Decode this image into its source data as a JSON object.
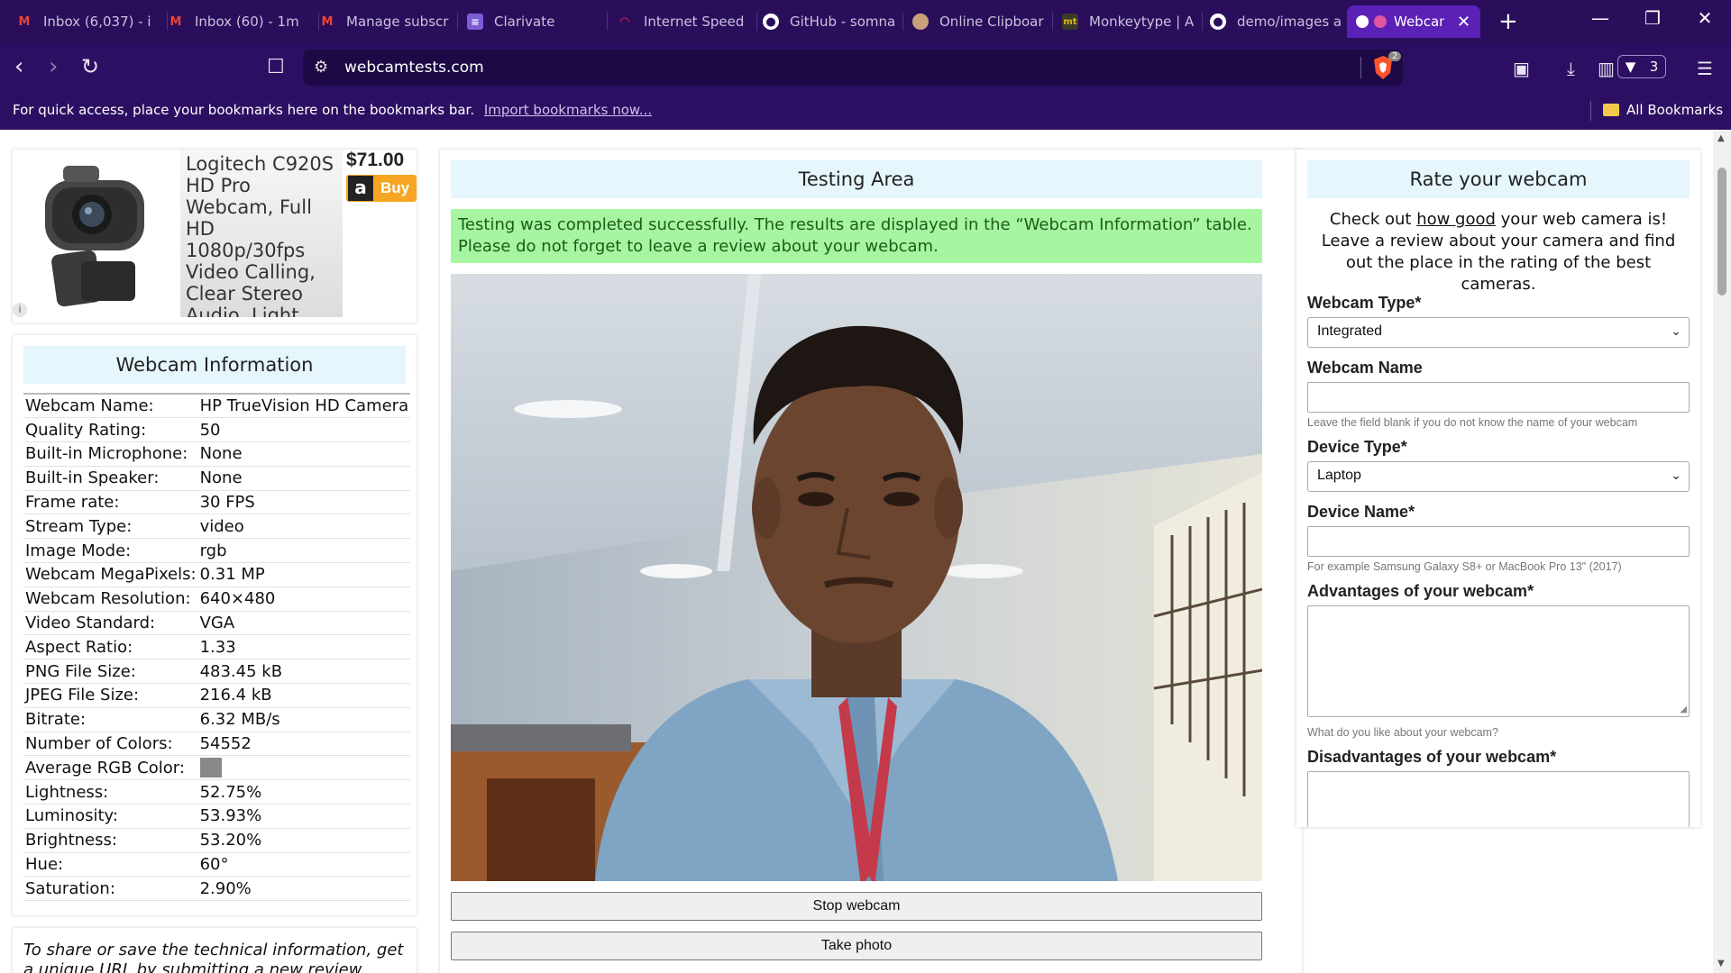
{
  "browser": {
    "tabs": [
      {
        "label": "Inbox (6,037) - i",
        "icon": "gmail-icon"
      },
      {
        "label": "Inbox (60) - 1m",
        "icon": "gmail-icon"
      },
      {
        "label": "Manage subscri",
        "icon": "gmail-icon"
      },
      {
        "label": "Clarivate",
        "icon": "clarivate-icon"
      },
      {
        "label": "Internet Speed",
        "icon": "speedtest-icon"
      },
      {
        "label": "GitHub - somna",
        "icon": "github-icon"
      },
      {
        "label": "Online Clipboar",
        "icon": "clipboard-icon"
      },
      {
        "label": "Monkeytype | A",
        "icon": "monkeytype-icon",
        "icon_text": "mt"
      },
      {
        "label": "demo/images a",
        "icon": "github-icon"
      },
      {
        "label": "Webcam",
        "icon": "webcam-icon",
        "active": true
      }
    ],
    "url": "webcamtests.com",
    "shield_count": "2",
    "rewards_count": "3",
    "bookmarks_bar": {
      "text": "For quick access, place your bookmarks here on the bookmarks bar.",
      "import_link": "Import bookmarks now...",
      "all_bookmarks": "All Bookmarks"
    }
  },
  "ad": {
    "description": "Logitech C920S HD Pro Webcam, Full HD 1080p/30fps Video Calling, Clear Stereo Audio, Light Correction",
    "price": "$71.00",
    "buy_label": "Buy",
    "amazon_logo": "a",
    "info_glyph": "i"
  },
  "webcam_info": {
    "heading": "Webcam Information",
    "rows": [
      {
        "key": "Webcam Name:",
        "value": "HP TrueVision HD Camera"
      },
      {
        "key": "Quality Rating:",
        "value": "50"
      },
      {
        "key": "Built-in Microphone:",
        "value": "None"
      },
      {
        "key": "Built-in Speaker:",
        "value": "None"
      },
      {
        "key": "Frame rate:",
        "value": "30 FPS"
      },
      {
        "key": "Stream Type:",
        "value": "video"
      },
      {
        "key": "Image Mode:",
        "value": "rgb"
      },
      {
        "key": "Webcam MegaPixels:",
        "value": "0.31 MP"
      },
      {
        "key": "Webcam Resolution:",
        "value": "640×480"
      },
      {
        "key": "Video Standard:",
        "value": "VGA"
      },
      {
        "key": "Aspect Ratio:",
        "value": "1.33"
      },
      {
        "key": "PNG File Size:",
        "value": "483.45 kB"
      },
      {
        "key": "JPEG File Size:",
        "value": "216.4 kB"
      },
      {
        "key": "Bitrate:",
        "value": "6.32 MB/s"
      },
      {
        "key": "Number of Colors:",
        "value": "54552"
      },
      {
        "key": "Average RGB Color:",
        "value": "",
        "swatch": "#888888"
      },
      {
        "key": "Lightness:",
        "value": "52.75%"
      },
      {
        "key": "Luminosity:",
        "value": "53.93%"
      },
      {
        "key": "Brightness:",
        "value": "53.20%"
      },
      {
        "key": "Hue:",
        "value": "60°"
      },
      {
        "key": "Saturation:",
        "value": "2.90%"
      }
    ]
  },
  "share_text": "To share or save the technical information, get a unique URL by submitting a new review about",
  "testing": {
    "heading": "Testing Area",
    "message": "Testing was completed successfully. The results are displayed in the “Webcam Information” table. Please do not forget to leave a review about your webcam.",
    "stop_label": "Stop webcam",
    "photo_label": "Take photo"
  },
  "rate": {
    "heading": "Rate your webcam",
    "intro_before": "Check out ",
    "intro_link": "how good",
    "intro_after": " your web camera is! Leave a review about your camera and find out the place in the rating of the best cameras.",
    "webcam_type_label": "Webcam Type*",
    "webcam_type_value": "Integrated",
    "webcam_name_label": "Webcam Name",
    "webcam_name_hint": "Leave the field blank if you do not know the name of your webcam",
    "device_type_label": "Device Type*",
    "device_type_value": "Laptop",
    "device_name_label": "Device Name*",
    "device_name_hint": "For example Samsung Galaxy S8+ or MacBook Pro 13\" (2017)",
    "advantages_label": "Advantages of your webcam*",
    "advantages_hint": "What do you like about your webcam?",
    "disadvantages_label": "Disadvantages of your webcam*"
  },
  "colors": {
    "tab_bar": "#2a0e5c",
    "active_tab": "#5b21b6",
    "heading_bg": "#e5f6fd",
    "success_bg": "#a6f5a0",
    "buy_orange": "#f6a623"
  }
}
